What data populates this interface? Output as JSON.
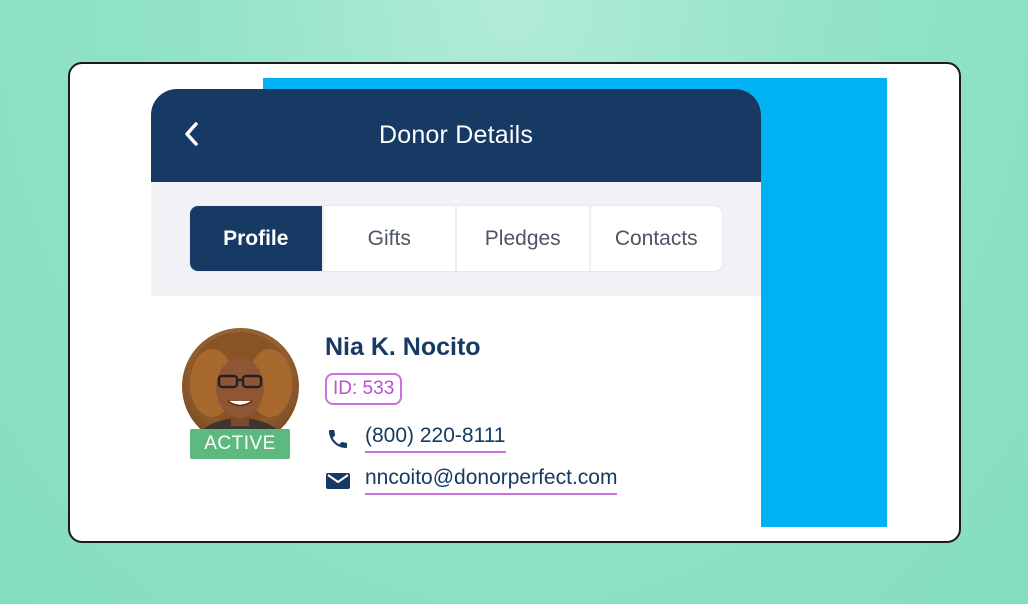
{
  "colors": {
    "background": "#92e3c6",
    "accent_blue": "#00b2f3",
    "header_navy": "#163a63",
    "status_green": "#5cba7e",
    "link_purple": "#cc6fe0"
  },
  "header": {
    "title": "Donor Details",
    "back_icon": "chevron-left-icon"
  },
  "tabs": [
    {
      "label": "Profile",
      "active": true
    },
    {
      "label": "Gifts",
      "active": false
    },
    {
      "label": "Pledges",
      "active": false
    },
    {
      "label": "Contacts",
      "active": false
    }
  ],
  "donor": {
    "name": "Nia K. Nocito",
    "id_label": "ID: 533",
    "status": "ACTIVE",
    "phone": "(800) 220-8111",
    "email": "nncoito@donorperfect.com",
    "phone_icon": "phone-icon",
    "email_icon": "envelope-icon",
    "avatar_icon": "avatar"
  }
}
